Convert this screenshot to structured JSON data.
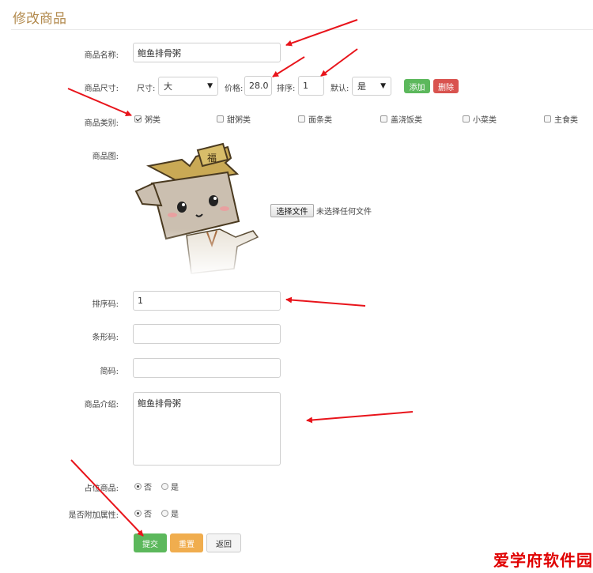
{
  "page": {
    "title": "修改商品"
  },
  "form": {
    "name": {
      "label": "商品名称:",
      "value": "鲍鱼排骨粥"
    },
    "size": {
      "label": "商品尺寸:",
      "size_label": "尺寸:",
      "size_value": "大",
      "price_label": "价格:",
      "price_value": "28.0",
      "sort_label": "排序:",
      "sort_value": "1",
      "default_label": "默认:",
      "default_value": "是",
      "add_label": "添加",
      "delete_label": "删除"
    },
    "category": {
      "label": "商品类别:",
      "items": [
        {
          "name": "粥类",
          "checked": true
        },
        {
          "name": "甜粥类",
          "checked": false
        },
        {
          "name": "面条类",
          "checked": false
        },
        {
          "name": "盖浇饭类",
          "checked": false
        },
        {
          "name": "小菜类",
          "checked": false
        },
        {
          "name": "主食类",
          "checked": false
        }
      ]
    },
    "image": {
      "label": "商品图:",
      "choose_file": "选择文件",
      "no_file": "未选择任何文件"
    },
    "sort_code": {
      "label": "排序码:",
      "value": "1"
    },
    "barcode": {
      "label": "条形码:",
      "value": ""
    },
    "short_code": {
      "label": "简码:",
      "value": ""
    },
    "intro": {
      "label": "商品介绍:",
      "value": "鲍鱼排骨粥"
    },
    "placeholder_product": {
      "label": "占位商品:",
      "options": [
        "否",
        "是"
      ],
      "selected": "否"
    },
    "extra_attr": {
      "label": "是否附加属性:",
      "options": [
        "否",
        "是"
      ],
      "selected": "否"
    },
    "buttons": {
      "submit": "提交",
      "reset": "重置",
      "back": "返回"
    }
  },
  "watermark": "爱学府软件园",
  "colors": {
    "title": "#b38b4f",
    "add_btn": "#5cb85c",
    "delete_btn": "#d9534f",
    "submit_btn": "#5cb85c",
    "reset_btn": "#f0ad4e",
    "arrow": "#e8141b"
  }
}
